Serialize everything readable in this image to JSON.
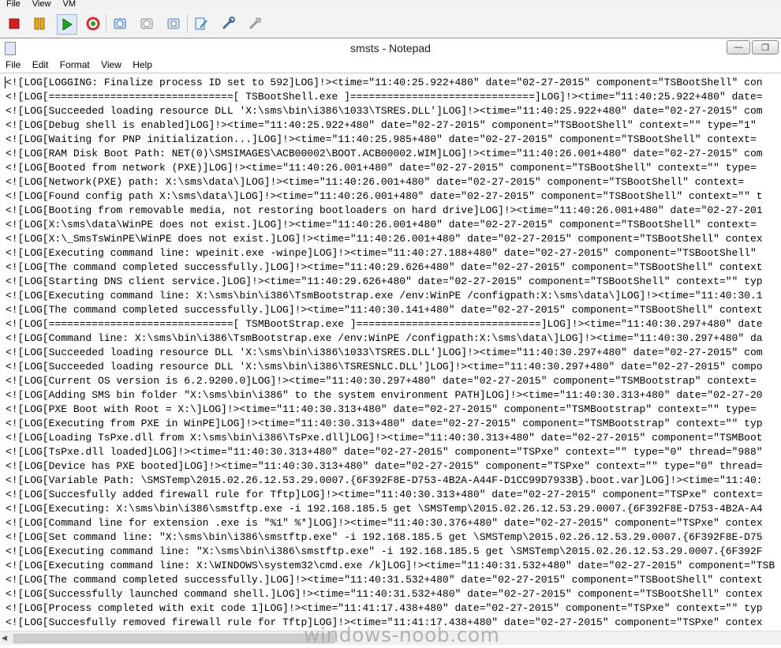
{
  "vm_menu": {
    "items": [
      "File",
      "View",
      "VM"
    ]
  },
  "toolbar": {
    "icons": [
      "stop-icon",
      "pause-icon",
      "play-icon",
      "reset-icon",
      "snapshot-icon",
      "revert-icon",
      "manage-snapshots-icon",
      "edit-settings-icon",
      "tools-icon",
      "connect-icon"
    ]
  },
  "window": {
    "title": "smsts - Notepad",
    "minimize": "—",
    "restore": "❐"
  },
  "notepad_menu": {
    "items": [
      "File",
      "Edit",
      "Format",
      "View",
      "Help"
    ]
  },
  "lines": [
    "<![LOG[LOGGING: Finalize process ID set to 592]LOG]!><time=\"11:40:25.922+480\" date=\"02-27-2015\" component=\"TSBootShell\" con",
    "<![LOG[==============================[ TSBootShell.exe ]==============================]LOG]!><time=\"11:40:25.922+480\" date=",
    "<![LOG[Succeeded loading resource DLL 'X:\\sms\\bin\\i386\\1033\\TSRES.DLL']LOG]!><time=\"11:40:25.922+480\" date=\"02-27-2015\" com",
    "<![LOG[Debug shell is enabled]LOG]!><time=\"11:40:25.922+480\" date=\"02-27-2015\" component=\"TSBootShell\" context=\"\" type=\"1\" ",
    "<![LOG[Waiting for PNP initialization...]LOG]!><time=\"11:40:25.985+480\" date=\"02-27-2015\" component=\"TSBootShell\" context=",
    "<![LOG[RAM Disk Boot Path: NET(0)\\SMSIMAGES\\ACB00002\\BOOT.ACB00002.WIM]LOG]!><time=\"11:40:26.001+480\" date=\"02-27-2015\" com",
    "<![LOG[Booted from network (PXE)]LOG]!><time=\"11:40:26.001+480\" date=\"02-27-2015\" component=\"TSBootShell\" context=\"\" type=",
    "<![LOG[Network(PXE) path: X:\\sms\\data\\]LOG]!><time=\"11:40:26.001+480\" date=\"02-27-2015\" component=\"TSBootShell\" context=",
    "<![LOG[Found config path X:\\sms\\data\\]LOG]!><time=\"11:40:26.001+480\" date=\"02-27-2015\" component=\"TSBootShell\" context=\"\" t",
    "<![LOG[Booting from removable media, not restoring bootloaders on hard drive]LOG]!><time=\"11:40:26.001+480\" date=\"02-27-201",
    "<![LOG[X:\\sms\\data\\WinPE does not exist.]LOG]!><time=\"11:40:26.001+480\" date=\"02-27-2015\" component=\"TSBootShell\" context=",
    "<![LOG[X:\\_SmsTsWinPE\\WinPE does not exist.]LOG]!><time=\"11:40:26.001+480\" date=\"02-27-2015\" component=\"TSBootShell\" contex",
    "<![LOG[Executing command line: wpeinit.exe -winpe]LOG]!><time=\"11:40:27.188+480\" date=\"02-27-2015\" component=\"TSBootShell\" ",
    "<![LOG[The command completed successfully.]LOG]!><time=\"11:40:29.626+480\" date=\"02-27-2015\" component=\"TSBootShell\" context",
    "<![LOG[Starting DNS client service.]LOG]!><time=\"11:40:29.626+480\" date=\"02-27-2015\" component=\"TSBootShell\" context=\"\" typ",
    "<![LOG[Executing command line: X:\\sms\\bin\\i386\\TsmBootstrap.exe /env:WinPE /configpath:X:\\sms\\data\\]LOG]!><time=\"11:40:30.1",
    "<![LOG[The command completed successfully.]LOG]!><time=\"11:40:30.141+480\" date=\"02-27-2015\" component=\"TSBootShell\" context",
    "<![LOG[==============================[ TSMBootStrap.exe ]==============================]LOG]!><time=\"11:40:30.297+480\" date",
    "<![LOG[Command line: X:\\sms\\bin\\i386\\TsmBootstrap.exe /env:WinPE /configpath:X:\\sms\\data\\]LOG]!><time=\"11:40:30.297+480\" da",
    "<![LOG[Succeeded loading resource DLL 'X:\\sms\\bin\\i386\\1033\\TSRES.DLL']LOG]!><time=\"11:40:30.297+480\" date=\"02-27-2015\" com",
    "<![LOG[Succeeded loading resource DLL 'X:\\sms\\bin\\i386\\TSRESNLC.DLL']LOG]!><time=\"11:40:30.297+480\" date=\"02-27-2015\" compo",
    "<![LOG[Current OS version is 6.2.9200.0]LOG]!><time=\"11:40:30.297+480\" date=\"02-27-2015\" component=\"TSMBootstrap\" context=",
    "<![LOG[Adding SMS bin folder \"X:\\sms\\bin\\i386\" to the system environment PATH]LOG]!><time=\"11:40:30.313+480\" date=\"02-27-20",
    "<![LOG[PXE Boot with Root = X:\\]LOG]!><time=\"11:40:30.313+480\" date=\"02-27-2015\" component=\"TSMBootstrap\" context=\"\" type=",
    "<![LOG[Executing from PXE in WinPE]LOG]!><time=\"11:40:30.313+480\" date=\"02-27-2015\" component=\"TSMBootstrap\" context=\"\" typ",
    "<![LOG[Loading TsPxe.dll from X:\\sms\\bin\\i386\\TsPxe.dll]LOG]!><time=\"11:40:30.313+480\" date=\"02-27-2015\" component=\"TSMBoot",
    "<![LOG[TsPxe.dll loaded]LOG]!><time=\"11:40:30.313+480\" date=\"02-27-2015\" component=\"TSPxe\" context=\"\" type=\"0\" thread=\"988\"",
    "<![LOG[Device has PXE booted]LOG]!><time=\"11:40:30.313+480\" date=\"02-27-2015\" component=\"TSPxe\" context=\"\" type=\"0\" thread=",
    "<![LOG[Variable Path: \\SMSTemp\\2015.02.26.12.53.29.0007.{6F392F8E-D753-4B2A-A44F-D1CC99D7933B}.boot.var]LOG]!><time=\"11:40:",
    "<![LOG[Succesfully added firewall rule for Tftp]LOG]!><time=\"11:40:30.313+480\" date=\"02-27-2015\" component=\"TSPxe\" context=",
    "<![LOG[Executing: X:\\sms\\bin\\i386\\smstftp.exe -i 192.168.185.5 get \\SMSTemp\\2015.02.26.12.53.29.0007.{6F392F8E-D753-4B2A-A4",
    "<![LOG[Command line for extension .exe is \"%1\" %*]LOG]!><time=\"11:40:30.376+480\" date=\"02-27-2015\" component=\"TSPxe\" contex",
    "<![LOG[Set command line: \"X:\\sms\\bin\\i386\\smstftp.exe\" -i 192.168.185.5 get \\SMSTemp\\2015.02.26.12.53.29.0007.{6F392F8E-D75",
    "<![LOG[Executing command line: \"X:\\sms\\bin\\i386\\smstftp.exe\" -i 192.168.185.5 get \\SMSTemp\\2015.02.26.12.53.29.0007.{6F392F",
    "<![LOG[Executing command line: X:\\WINDOWS\\system32\\cmd.exe /k]LOG]!><time=\"11:40:31.532+480\" date=\"02-27-2015\" component=\"TSB",
    "<![LOG[The command completed successfully.]LOG]!><time=\"11:40:31.532+480\" date=\"02-27-2015\" component=\"TSBootShell\" context",
    "<![LOG[Successfully launched command shell.]LOG]!><time=\"11:40:31.532+480\" date=\"02-27-2015\" component=\"TSBootShell\" contex",
    "<![LOG[Process completed with exit code 1]LOG]!><time=\"11:41:17.438+480\" date=\"02-27-2015\" component=\"TSPxe\" context=\"\" typ",
    "<![LOG[Succesfully removed firewall rule for Tftp]LOG]!><time=\"11:41:17.438+480\" date=\"02-27-2015\" component=\"TSPxe\" contex"
  ],
  "watermark": "windows-noob.com",
  "colors": {
    "stop": "#d42020",
    "pause": "#e8a81c",
    "play": "#2aa02a",
    "reset": "#d03030",
    "accent_blue": "#3a78c2"
  }
}
